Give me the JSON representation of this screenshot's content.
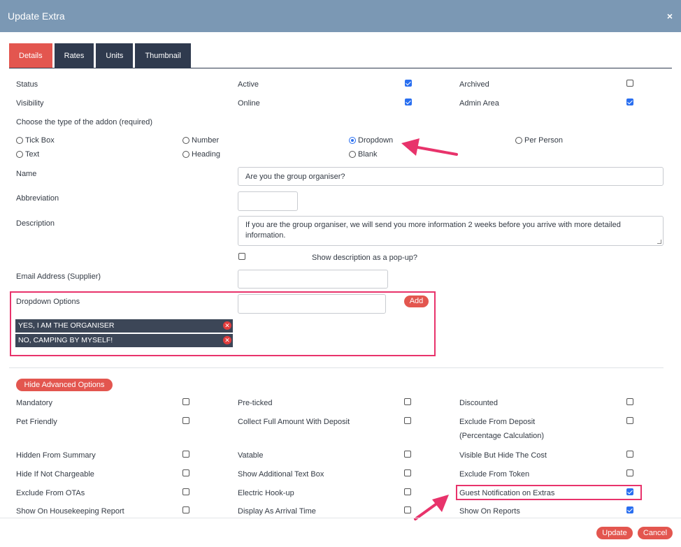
{
  "dialog": {
    "title": "Update Extra",
    "close_label": "×"
  },
  "tabs": [
    {
      "label": "Details",
      "active": true
    },
    {
      "label": "Rates",
      "active": false
    },
    {
      "label": "Units",
      "active": false
    },
    {
      "label": "Thumbnail",
      "active": false
    }
  ],
  "status": {
    "label": "Status",
    "active_label": "Active",
    "active_checked": true,
    "archived_label": "Archived",
    "archived_checked": false
  },
  "visibility": {
    "label": "Visibility",
    "online_label": "Online",
    "online_checked": true,
    "admin_label": "Admin Area",
    "admin_checked": true
  },
  "addon_type": {
    "label": "Choose the type of the addon (required)",
    "options": [
      "Tick Box",
      "Number",
      "Dropdown",
      "Per Person",
      "Text",
      "Heading",
      "Blank"
    ],
    "selected": "Dropdown"
  },
  "name": {
    "label": "Name",
    "value": "Are you the group organiser?"
  },
  "abbreviation": {
    "label": "Abbreviation",
    "value": ""
  },
  "description": {
    "label": "Description",
    "value": "If you are the group organiser, we will send you more information 2 weeks before you arrive with more detailed information.",
    "popup_label": "Show description as a pop-up?",
    "popup_checked": false
  },
  "email": {
    "label": "Email Address (Supplier)",
    "value": ""
  },
  "dropdown_options": {
    "label": "Dropdown Options",
    "input_value": "",
    "add_label": "Add",
    "items": [
      "YES, I AM THE ORGANISER",
      "NO, CAMPING BY MYSELF!"
    ]
  },
  "advanced": {
    "toggle_label": "Hide Advanced Options",
    "col1": [
      {
        "label": "Mandatory",
        "checked": false
      },
      {
        "label": "Pet Friendly",
        "checked": false
      },
      {
        "label": "Hidden From Summary",
        "checked": false
      },
      {
        "label": "Hide If Not Chargeable",
        "checked": false
      },
      {
        "label": "Exclude From OTAs",
        "checked": false
      },
      {
        "label": "Show On Housekeeping Report",
        "checked": false
      }
    ],
    "col2": [
      {
        "label": "Pre-ticked",
        "checked": false
      },
      {
        "label": "Collect Full Amount With Deposit",
        "checked": false
      },
      {
        "label": "Vatable",
        "checked": false
      },
      {
        "label": "Show Additional Text Box",
        "checked": false
      },
      {
        "label": "Electric Hook-up",
        "checked": false
      },
      {
        "label": "Display As Arrival Time",
        "checked": false
      }
    ],
    "col3": [
      {
        "label": "Discounted",
        "checked": false
      },
      {
        "label": "Exclude From Deposit",
        "label2": "(Percentage Calculation)",
        "checked": false
      },
      {
        "label": "Visible But Hide The Cost",
        "checked": false
      },
      {
        "label": "Exclude From Token",
        "checked": false
      },
      {
        "label": "Guest Notification on Extras",
        "checked": true
      },
      {
        "label": "Show On Reports",
        "checked": true
      }
    ]
  },
  "footer": {
    "update_label": "Update",
    "cancel_label": "Cancel"
  },
  "colors": {
    "header": "#7b98b4",
    "tab_active": "#e3564f",
    "tab": "#2f3a4e",
    "highlight": "#e8336b",
    "checkbox": "#2a6ff0"
  }
}
